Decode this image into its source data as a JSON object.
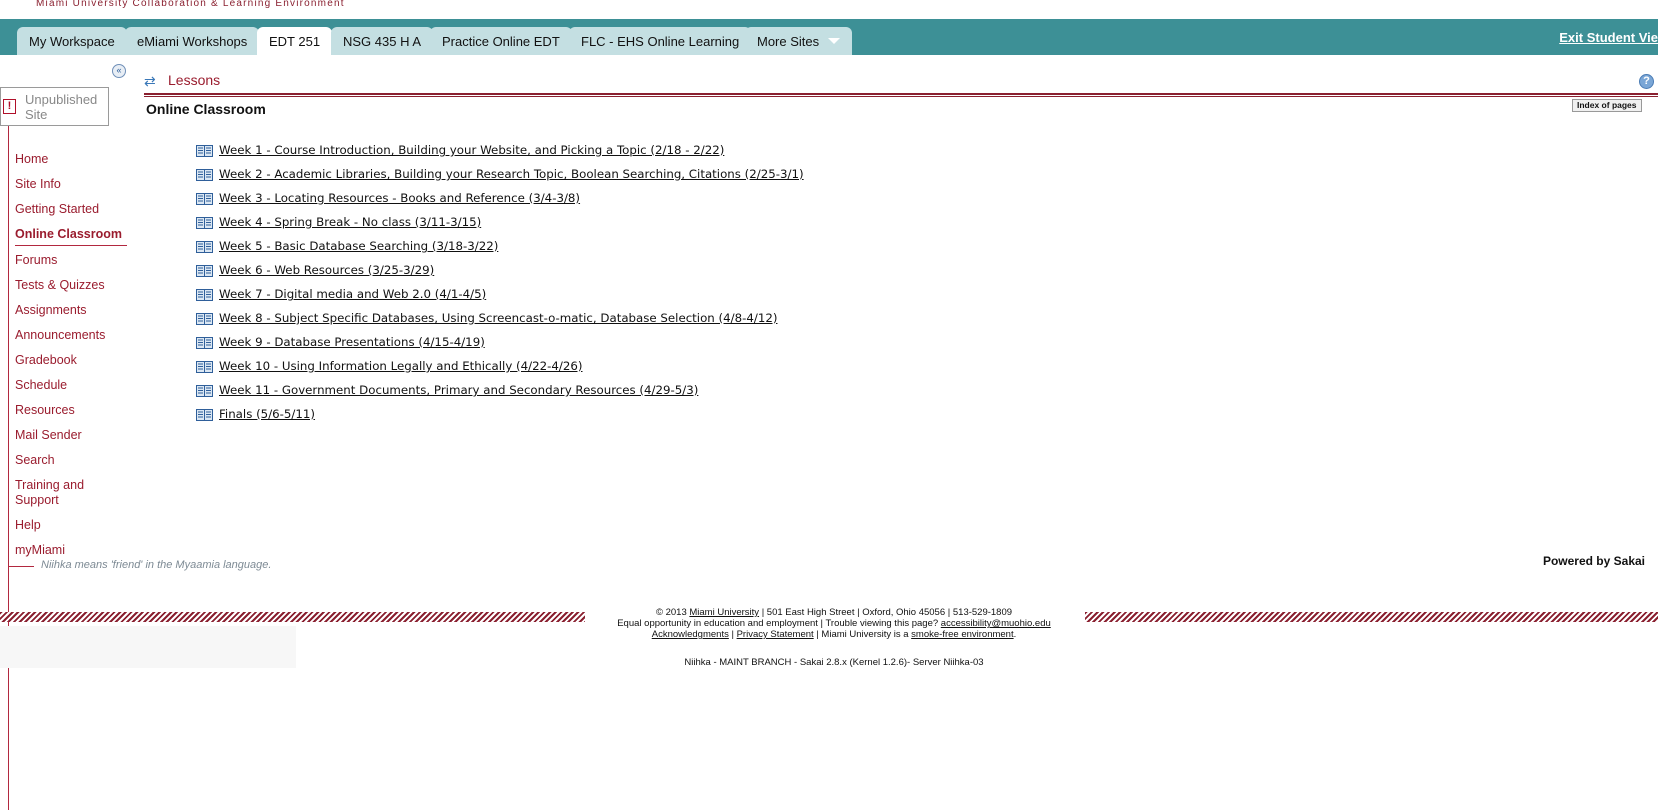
{
  "header": {
    "brand_text": "Miami University Collaboration & Learning Environment",
    "exit_label": "Exit Student Vie"
  },
  "tabs": [
    {
      "label": "My Workspace",
      "active": false
    },
    {
      "label": "eMiami Workshops",
      "active": false
    },
    {
      "label": "EDT 251",
      "active": true
    },
    {
      "label": "NSG 435 H A",
      "active": false
    },
    {
      "label": "Practice Online EDT",
      "active": false
    },
    {
      "label": "FLC - EHS Online Learning",
      "active": false
    },
    {
      "label": "More Sites",
      "active": false
    }
  ],
  "sidebar": {
    "collapse_glyph": "«",
    "unpublished_icon": "!",
    "unpublished_label": "Unpublished Site",
    "items": [
      {
        "label": "Home"
      },
      {
        "label": "Site Info"
      },
      {
        "label": "Getting Started"
      },
      {
        "label": "Online Classroom",
        "active": true
      },
      {
        "label": "Forums"
      },
      {
        "label": "Tests & Quizzes"
      },
      {
        "label": "Assignments"
      },
      {
        "label": "Announcements"
      },
      {
        "label": "Gradebook"
      },
      {
        "label": "Schedule"
      },
      {
        "label": "Resources"
      },
      {
        "label": "Mail Sender"
      },
      {
        "label": "Search"
      },
      {
        "label": "Training and Support"
      },
      {
        "label": "Help"
      },
      {
        "label": "myMiami"
      }
    ],
    "tagline": "Niihka means 'friend' in the Myaamia language."
  },
  "main": {
    "tool_title": "Lessons",
    "help_glyph": "?",
    "refresh_glyph": "⇄",
    "page_title": "Online Classroom",
    "index_label": "Index of pages",
    "lessons": [
      "Week 1 - Course Introduction, Building your Website, and Picking a Topic (2/18 - 2/22)",
      "Week 2 - Academic Libraries, Building your Research Topic, Boolean Searching, Citations (2/25-3/1)",
      "Week 3 - Locating Resources - Books and Reference (3/4-3/8)",
      "Week 4 - Spring Break - No class (3/11-3/15)",
      "Week 5 - Basic Database Searching (3/18-3/22)",
      "Week 6 - Web Resources (3/25-3/29)",
      "Week 7 - Digital media and Web 2.0 (4/1-4/5)",
      "Week 8 - Subject Specific Databases, Using Screencast-o-matic, Database Selection (4/8-4/12)",
      "Week 9 - Database Presentations (4/15-4/19)",
      "Week 10 - Using Information Legally and Ethically (4/22-4/26)",
      "Week 11 - Government Documents, Primary and Secondary Resources (4/29-5/3)",
      "Finals (5/6-5/11)"
    ],
    "powered_by": "Powered by Sakai"
  },
  "footer": {
    "copyright_prefix": "© 2013 ",
    "university_link": "Miami University",
    "address": " | 501 East High Street | Oxford, Ohio 45056 | 513-529-1809",
    "equal_opp": "Equal opportunity in education and employment | Trouble viewing this page? ",
    "accessibility_email": "accessibility@muohio.edu",
    "acknowledgments": "Acknowledgments",
    "sep": " | ",
    "privacy": "Privacy Statement",
    "smoke_free_prefix": " | Miami University is a ",
    "smoke_free_link": "smoke-free environment",
    "period": ".",
    "server_info": "Niihka - MAINT BRANCH - Sakai 2.8.x (Kernel 1.2.6)- Server Niihka-03"
  },
  "colors": {
    "tabbar": "#3d9096",
    "tab_inactive": "#c4dfe2",
    "brand_red": "#9a1c2e",
    "rule_red": "#8a2030"
  }
}
